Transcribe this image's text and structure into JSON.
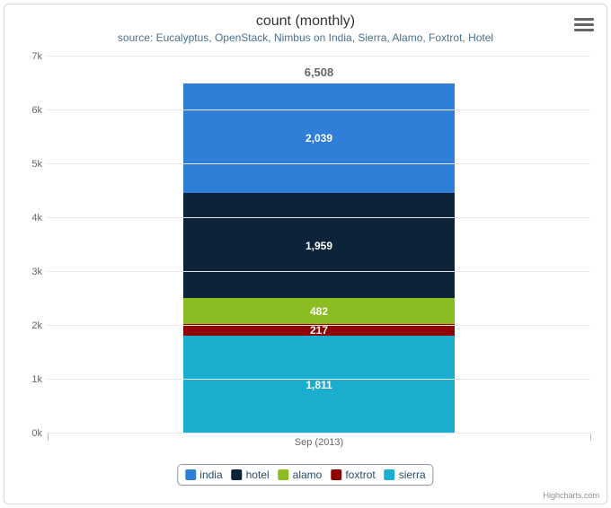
{
  "title": "count (monthly)",
  "subtitle": "source: Eucalyptus, OpenStack, Nimbus on India, Sierra, Alamo, Foxtrot, Hotel",
  "menu_icon": "chart-menu",
  "credits": "Highcharts.com",
  "y_axis": {
    "ticks": [
      "0k",
      "1k",
      "2k",
      "3k",
      "4k",
      "5k",
      "6k",
      "7k"
    ],
    "max": 7000
  },
  "x_axis": {
    "label": "Sep (2013)"
  },
  "stack_total_label": "6,508",
  "legend": [
    {
      "name": "india",
      "color": "#2f7ed8"
    },
    {
      "name": "hotel",
      "color": "#0d233a"
    },
    {
      "name": "alamo",
      "color": "#8bbc21"
    },
    {
      "name": "foxtrot",
      "color": "#910000"
    },
    {
      "name": "sierra",
      "color": "#1aadce"
    }
  ],
  "segments": [
    {
      "name": "sierra",
      "value": 1811,
      "label": "1,811",
      "color": "#1aadce"
    },
    {
      "name": "foxtrot",
      "value": 217,
      "label": "217",
      "color": "#910000"
    },
    {
      "name": "alamo",
      "value": 482,
      "label": "482",
      "color": "#8bbc21"
    },
    {
      "name": "hotel",
      "value": 1959,
      "label": "1,959",
      "color": "#0d233a"
    },
    {
      "name": "india",
      "value": 2039,
      "label": "2,039",
      "color": "#2f7ed8"
    }
  ],
  "chart_data": {
    "type": "bar",
    "stacked": true,
    "title": "count (monthly)",
    "subtitle": "source: Eucalyptus, OpenStack, Nimbus on India, Sierra, Alamo, Foxtrot, Hotel",
    "xlabel": "",
    "ylabel": "",
    "ylim": [
      0,
      7000
    ],
    "categories": [
      "Sep (2013)"
    ],
    "series": [
      {
        "name": "india",
        "values": [
          2039
        ],
        "color": "#2f7ed8"
      },
      {
        "name": "hotel",
        "values": [
          1959
        ],
        "color": "#0d233a"
      },
      {
        "name": "alamo",
        "values": [
          482
        ],
        "color": "#8bbc21"
      },
      {
        "name": "foxtrot",
        "values": [
          217
        ],
        "color": "#910000"
      },
      {
        "name": "sierra",
        "values": [
          1811
        ],
        "color": "#1aadce"
      }
    ],
    "totals": [
      6508
    ]
  }
}
